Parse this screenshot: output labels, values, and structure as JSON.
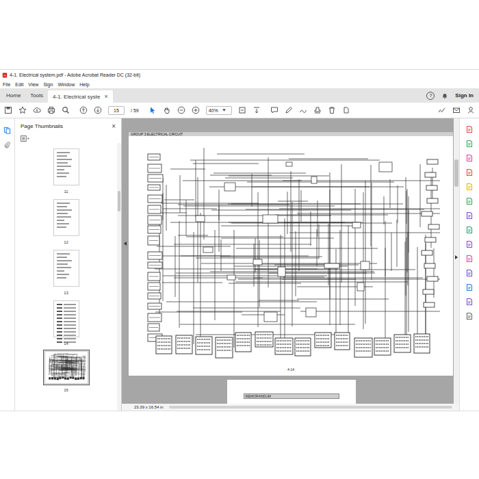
{
  "window": {
    "title": "4-1. Electrical system.pdf - Adobe Acrobat Reader DC (32-bit)"
  },
  "menu": [
    "File",
    "Edit",
    "View",
    "Sign",
    "Window",
    "Help"
  ],
  "tabs": [
    {
      "label": "Home",
      "selected": false,
      "closable": false,
      "close": ""
    },
    {
      "label": "Tools",
      "selected": false,
      "closable": false,
      "close": ""
    },
    {
      "label": "4-1. Electrical syste",
      "selected": true,
      "closable": true,
      "close": "×"
    }
  ],
  "account": {
    "help": "?",
    "sign_in": "Sign In"
  },
  "toolbar": {
    "page": "15",
    "page_count": "/ 59",
    "zoom": "40%"
  },
  "thumbnails_panel": {
    "title": "Page Thumbnails",
    "close": "×",
    "pages": [
      {
        "label": "11",
        "selected": false,
        "kind": "text"
      },
      {
        "label": "12",
        "selected": false,
        "kind": "text"
      },
      {
        "label": "13",
        "selected": false,
        "kind": "text"
      },
      {
        "label": "14",
        "selected": false,
        "kind": "table"
      },
      {
        "label": "15",
        "selected": true,
        "kind": "schematic"
      }
    ]
  },
  "document": {
    "header": "GROUP 3 ELECTRICAL CIRCUIT",
    "page_number": "4-14",
    "next_page_heading": "MEMORANDUM"
  },
  "status_bar": {
    "page_size": "23.39 x 16.54 in"
  }
}
